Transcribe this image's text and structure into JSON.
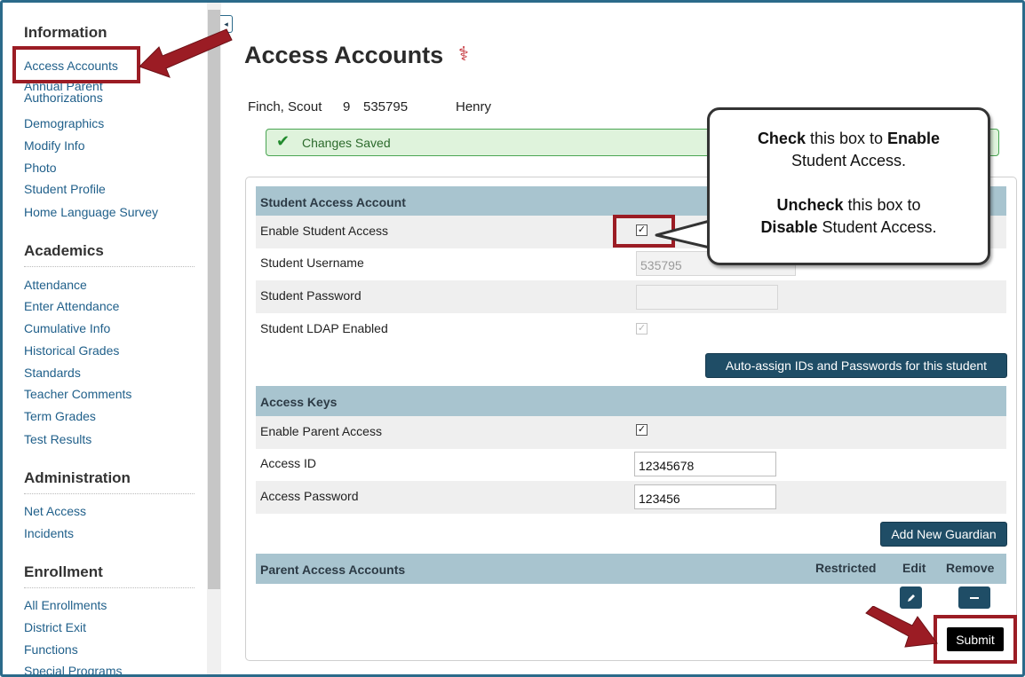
{
  "sidebar": {
    "collapse_glyph": "◂",
    "sections": [
      {
        "title": "Information",
        "items": [
          "Access Accounts",
          "Annual Parent Authorizations",
          "Demographics",
          "Modify Info",
          "Photo",
          "Student Profile",
          "Home Language Survey"
        ]
      },
      {
        "title": "Academics",
        "items": [
          "Attendance",
          "Enter Attendance",
          "Cumulative Info",
          "Historical Grades",
          "Standards",
          "Teacher Comments",
          "Term Grades",
          "Test Results"
        ]
      },
      {
        "title": "Administration",
        "items": [
          "Net Access",
          "Incidents"
        ]
      },
      {
        "title": "Enrollment",
        "items": [
          "All Enrollments",
          "District Exit",
          "Functions",
          "Special Programs"
        ]
      }
    ]
  },
  "page": {
    "title": "Access Accounts",
    "title_icon": "⚕",
    "student": {
      "name": "Finch, Scout",
      "grade": "9",
      "id": "535795",
      "school": "Henry"
    },
    "alert": {
      "icon": "✔",
      "text": "Changes Saved"
    }
  },
  "student_access": {
    "header": "Student Access Account",
    "enable_label": "Enable Student Access",
    "enable_checked": true,
    "username_label": "Student Username",
    "username_value": "535795",
    "password_label": "Student Password",
    "password_value": "",
    "ldap_label": "Student LDAP Enabled",
    "ldap_checked": true,
    "auto_assign_label": "Auto-assign IDs and Passwords for this student"
  },
  "access_keys": {
    "header": "Access Keys",
    "enable_parent_label": "Enable Parent Access",
    "enable_parent_checked": true,
    "access_id_label": "Access ID",
    "access_id_value": "12345678",
    "access_password_label": "Access Password",
    "access_password_value": "123456",
    "add_guardian_label": "Add New Guardian"
  },
  "parent_accounts": {
    "header": "Parent Access Accounts",
    "columns": [
      "Restricted",
      "Edit",
      "Remove"
    ],
    "edit_icon": "pencil-icon",
    "remove_icon": "minus-icon"
  },
  "submit_label": "Submit",
  "callout": {
    "line1_bold": "Check",
    "line1_mid": " this box to ",
    "line1_bold2": "Enable",
    "line2": "Student Access.",
    "line3_bold": "Uncheck",
    "line3_rest": " this box to",
    "line4_bold": "Disable",
    "line4_rest": " Student Access."
  },
  "colors": {
    "section_header": "#a8c4cf",
    "button": "#1f4d66",
    "link": "#1f5f8a",
    "annotation": "#9b1c24",
    "success": "#dff3dc"
  }
}
